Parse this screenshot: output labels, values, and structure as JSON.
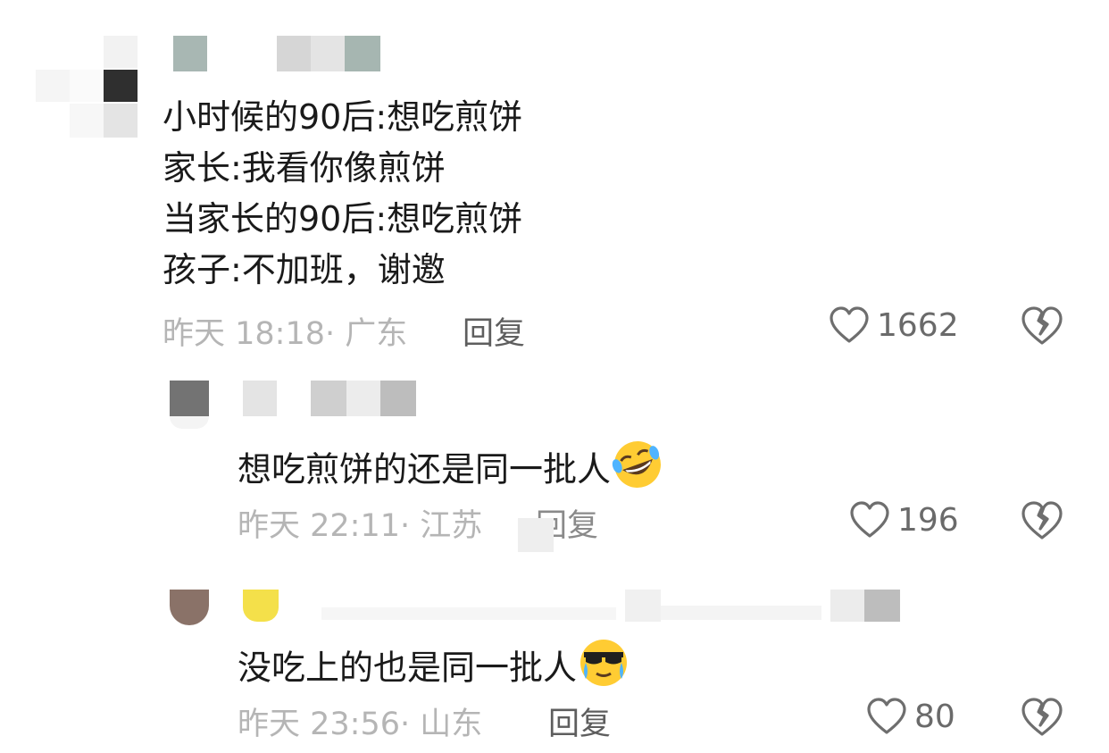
{
  "comments": [
    {
      "text_lines": [
        "小时候的90后:想吃煎饼",
        "家长:我看你像煎饼",
        "当家长的90后:想吃煎饼",
        "孩子:不加班，谢邀"
      ],
      "meta": "昨天 18:18· 广东",
      "reply_label": "回复",
      "likes": "1662"
    },
    {
      "text": "想吃煎饼的还是同一批人",
      "emoji": "rofl-emoji",
      "meta": "昨天 22:11· 江苏",
      "reply_label": "回复",
      "likes": "196"
    },
    {
      "text": "没吃上的也是同一批人",
      "emoji": "cool-crying-emoji",
      "meta": "昨天 23:56· 山东",
      "reply_label": "回复",
      "likes": "80"
    }
  ],
  "colors": {
    "text": "#1a1a1a",
    "meta": "#b5b5b5",
    "reply": "#5e5e5e",
    "count": "#6a6a6a",
    "icon": "#6e6e6e"
  }
}
